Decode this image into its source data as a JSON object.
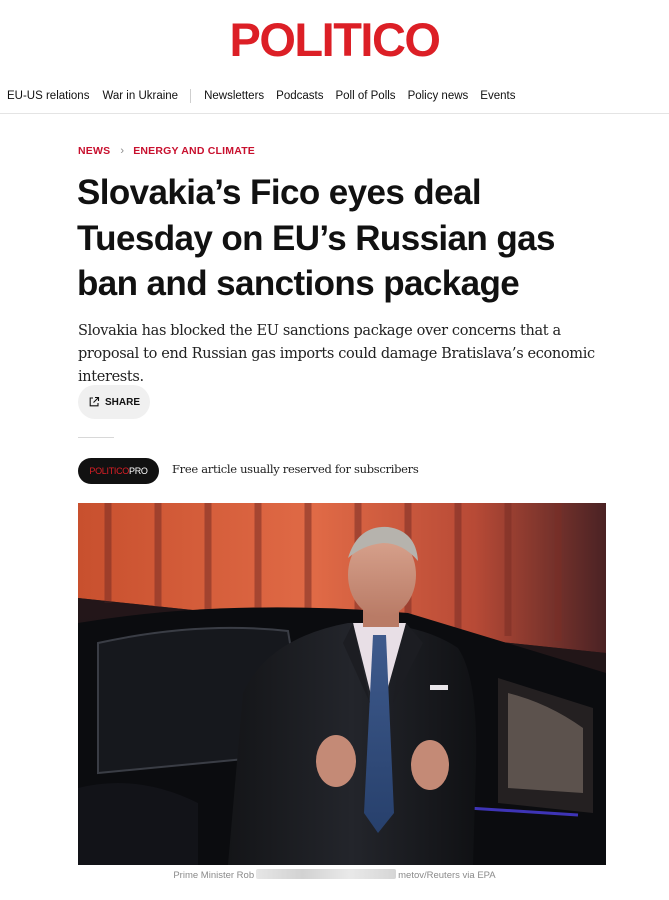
{
  "brand": {
    "logo_text": "POLITICO",
    "logo_color": "#dc1f26"
  },
  "nav": {
    "items": [
      {
        "label": "EU-US relations"
      },
      {
        "label": "War in Ukraine"
      },
      {
        "label": "Newsletters"
      },
      {
        "label": "Podcasts"
      },
      {
        "label": "Poll of Polls"
      },
      {
        "label": "Policy news"
      },
      {
        "label": "Events"
      }
    ]
  },
  "breadcrumb": {
    "section": "NEWS",
    "subsection": "ENERGY AND CLIMATE",
    "separator": "›",
    "color": "#c8102e"
  },
  "article": {
    "headline": "Slovakia’s Fico eyes deal Tuesday on EU’s Russian gas ban and sanctions package",
    "dek": "Slovakia has blocked the EU sanctions package over concerns that a proposal to end Russian gas imports could damage Bratislava’s economic interests.",
    "share_label": "SHARE",
    "share_icon": "share-external-icon"
  },
  "pro": {
    "badge_politico": "POLITICO",
    "badge_pro": "PRO",
    "note": "Free article usually reserved for subscribers"
  },
  "photo": {
    "caption_start": "Prime Minister Rob",
    "caption_end": "metov/Reuters via EPA"
  }
}
